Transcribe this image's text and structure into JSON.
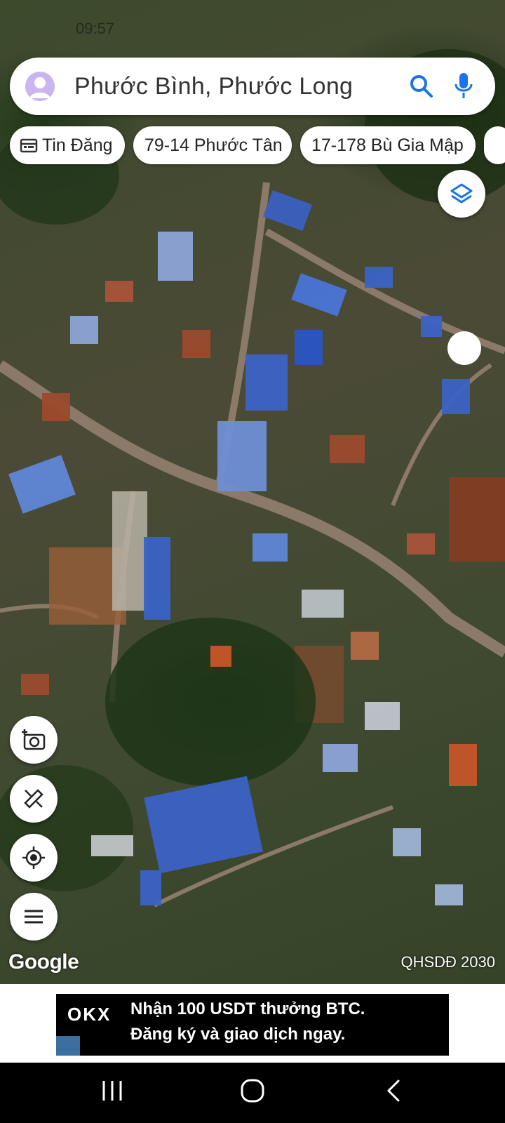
{
  "status_bar": {
    "time": "09:57"
  },
  "search": {
    "query": "Phước Bình, Phước Long"
  },
  "chips": [
    {
      "label": "Tin Đăng",
      "icon": "calendar-icon"
    },
    {
      "label": "79-14 Phước Tân"
    },
    {
      "label": "17-178 Bù Gia Mập"
    }
  ],
  "map": {
    "google_label": "Google",
    "attribution": "QHSDĐ 2030"
  },
  "ad": {
    "logo": "OKX",
    "line1": "Nhận 100 USDT thưởng BTC.",
    "line2": "Đăng ký và giao dịch ngay."
  },
  "icons": {
    "layers": "layers-icon",
    "add_photo": "add-photo-icon",
    "measure": "ruler-icon",
    "my_location": "my-location-icon",
    "menu": "menu-icon"
  },
  "colors": {
    "accent_blue": "#1a73e8",
    "roof_blue": "#3b63c7",
    "roof_red": "#9c4a2e"
  }
}
